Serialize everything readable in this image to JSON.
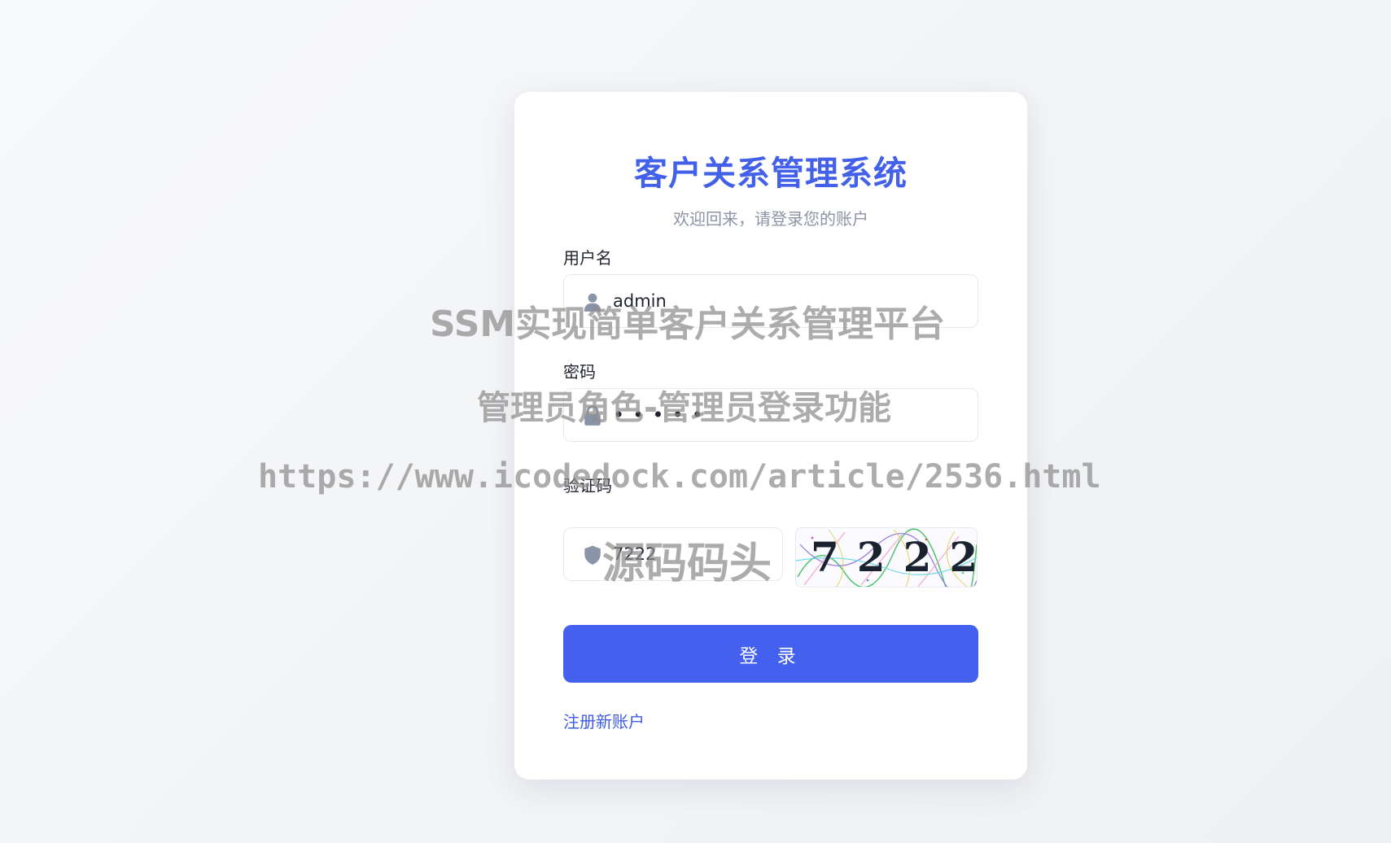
{
  "login": {
    "title": "客户关系管理系统",
    "subtitle": "欢迎回来，请登录您的账户",
    "username": {
      "label": "用户名",
      "value": "admin",
      "icon": "user-icon"
    },
    "password": {
      "label": "密码",
      "value": "•••••",
      "icon": "lock-icon"
    },
    "captcha": {
      "label": "验证码",
      "value": "7222",
      "icon": "shield-icon",
      "image_text": "7222"
    },
    "login_button": "登 录",
    "register_link": "注册新账户"
  },
  "colors": {
    "accent": "#4460ee",
    "title": "#4361e8",
    "subtitle": "#8c93a6",
    "icon": "#8a94a8"
  },
  "watermark": {
    "line1": "SSM实现简单客户关系管理平台",
    "line2": "管理员角色-管理员登录功能",
    "line3": "https://www.icodedock.com/article/2536.html",
    "line4": "源码码头"
  }
}
